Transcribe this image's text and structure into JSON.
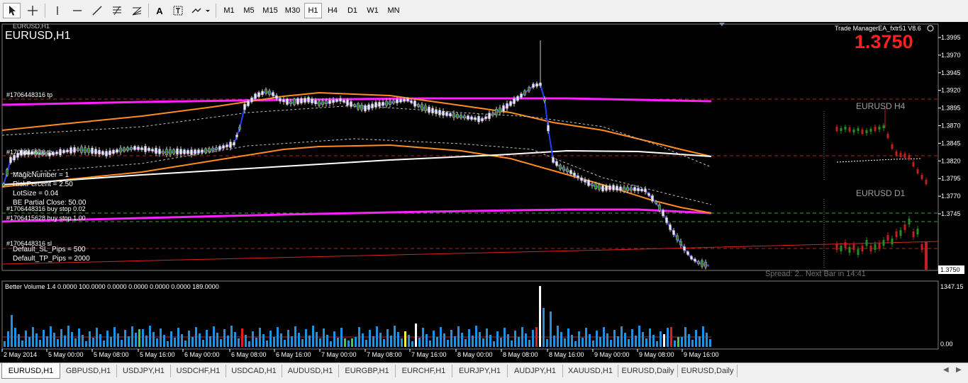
{
  "toolbar": {
    "tools": [
      "cursor-icon",
      "crosshair-icon",
      "vertical-line-icon",
      "horizontal-line-icon",
      "trendline-icon",
      "fibonacci-icon",
      "fibo-fan-icon",
      "text-icon",
      "text-label-icon",
      "arrows-icon"
    ],
    "text_tool": "A",
    "periods": [
      "M1",
      "M5",
      "M15",
      "M30",
      "H1",
      "H4",
      "D1",
      "W1",
      "MN"
    ],
    "active_period": "H1"
  },
  "chart": {
    "symbol_title": "EURUSD,H1",
    "small_title": "EURUSD,H1",
    "ea_name": "Trade ManagerEA_fxtr51 V8.6",
    "current_price": "1.3750",
    "price_axis": [
      "1.3995",
      "1.3970",
      "1.3945",
      "1.3920",
      "1.3895",
      "1.3870",
      "1.3845",
      "1.3820",
      "1.3795",
      "1.3770",
      "1.3745"
    ],
    "price_marker": "1.3750",
    "labels": {
      "tp": "#1706448316 tp",
      "order2": "#1706415628 tp",
      "sl": "#1706448316 sl",
      "buystop1": "#1706448316 buy stop 0.02",
      "buystop2": "#1706415628 buy stop 1.00"
    },
    "settings": [
      "MagicNumber = 1",
      "RiskPercent = 2.50",
      "LotSize = 0.04",
      "BE Partial Close: 50.00"
    ],
    "defaults": [
      "Default_SL_Pips = 500",
      "Default_TP_Pips = 2000"
    ],
    "mini_h4": "EURUSD H4",
    "mini_d1": "EURUSD D1",
    "spread_text": "Spread: 2.. Next Bar in 14:41"
  },
  "volume": {
    "title": "Better Volume 1.4 0.0000 100.0000 0.0000 0.0000 0.0000 0.0000 189.0000",
    "axis_top": "1347.15",
    "axis_bottom": "0.00"
  },
  "time_axis": [
    "2 May 2014",
    "5 May 00:00",
    "5 May 08:00",
    "5 May 16:00",
    "6 May 00:00",
    "6 May 08:00",
    "6 May 16:00",
    "7 May 00:00",
    "7 May 08:00",
    "7 May 16:00",
    "8 May 00:00",
    "8 May 08:00",
    "8 May 16:00",
    "9 May 00:00",
    "9 May 08:00",
    "9 May 16:00"
  ],
  "tabs": [
    "EURUSD,H1",
    "GBPUSD,H1",
    "USDJPY,H1",
    "USDCHF,H1",
    "USDCAD,H1",
    "AUDUSD,H1",
    "EURGBP,H1",
    "EURCHF,H1",
    "EURJPY,H1",
    "AUDJPY,H1",
    "XAUUSD,H1",
    "EURUSD,Daily",
    "EURUSD,Daily"
  ],
  "tab_scroll": [
    "tab-scroll-left-icon",
    "tab-scroll-right-icon"
  ]
}
